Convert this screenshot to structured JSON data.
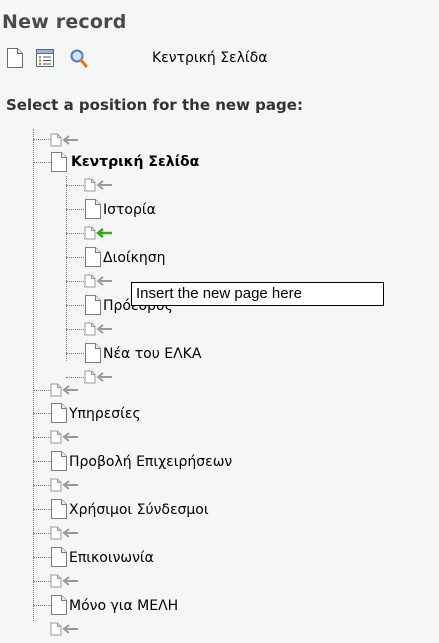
{
  "title": "New record",
  "toolbar": {
    "icons": [
      "page-icon",
      "list-icon",
      "search-icon"
    ],
    "label": "Κεντρική Σελίδα"
  },
  "instruction": "Select a position for the new page:",
  "tree": {
    "root": "Κεντρική Σελίδα",
    "children": [
      "Ιστορία",
      "Διοίκηση",
      "Πρόεδρος",
      "Νέα του ΕΛΚΑ"
    ],
    "siblings": [
      "Υπηρεσίες",
      "Προβολή Επιχειρήσεων",
      "Χρήσιμοι Σύνδεσμοι",
      "Επικοινωνία",
      "Μόνο για ΜΕΛΗ"
    ]
  },
  "tooltip": "Insert the new page here",
  "colors": {
    "active_arrow": "#3aa32a",
    "inactive_arrow": "#9a9a9a"
  }
}
